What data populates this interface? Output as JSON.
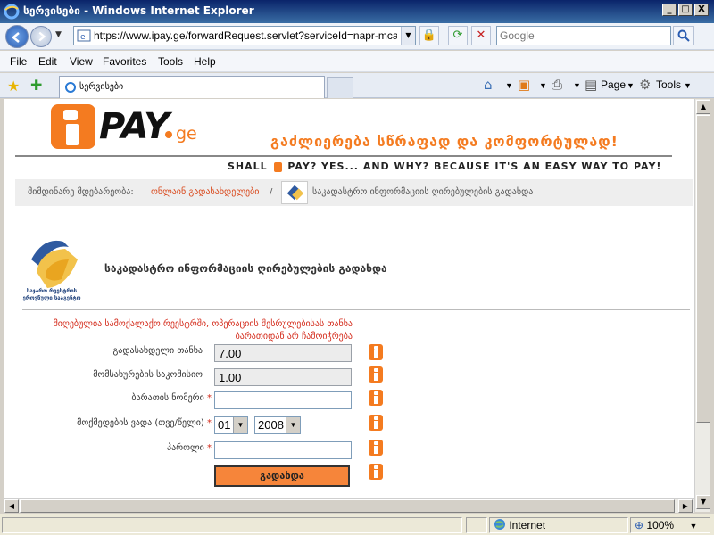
{
  "window": {
    "title": "სერვისები - Windows Internet Explorer",
    "minimize": "_",
    "maximize": "□",
    "close": "X"
  },
  "nav": {
    "url": "https://www.ipay.ge/forwardRequest.servlet?serviceId=napr-mcadmap",
    "search_placeholder": "Google"
  },
  "menu": {
    "items": [
      "File",
      "Edit",
      "View",
      "Favorites",
      "Tools",
      "Help"
    ]
  },
  "tabs": {
    "active_label": "სერვისები"
  },
  "commands": {
    "page": "Page",
    "tools": "Tools"
  },
  "header": {
    "logo_pay": "PAY",
    "logo_ge": "ge",
    "slogan_ka": "გაძლიერება სწრაფად და კომფორტულად!",
    "slogan_en_part1": "SHALL",
    "slogan_en_part2": "PAY? YES... AND WHY? BECAUSE IT'S AN EASY WAY TO PAY!"
  },
  "breadcrumb": {
    "current_label": "მიმდინარე მდებარეობა:",
    "link": "ონლაინ გადასახდელები",
    "separator": "/",
    "last": "საკადასტრო ინფორმაციის ღირებულების გადახდა"
  },
  "registry": {
    "caption": "საჯარო რეესტრის ეროვნული სააგენტო"
  },
  "page": {
    "heading": "საკადასტრო ინფორმაციის ღირებულების გადახდა",
    "notice": "მიღებულია სამოქალაქო რეესტრში, ოპერაციის შესრულებისას თანხა ბარათიდან არ ჩამოიჭრება"
  },
  "form": {
    "amount_label": "გადასახდელი თანხა",
    "amount_value": "7.00",
    "fee_label": "მომსახურების საკომისიო",
    "fee_value": "1.00",
    "card_label": "ბარათის ნომერი",
    "card_value": "",
    "expiry_label": "მოქმედების ვადა (თვე/წელი)",
    "expiry_month": "01",
    "expiry_year": "2008",
    "password_label": "პაროლი",
    "password_value": "",
    "required_mark": "*",
    "submit_label": "გადახდა"
  },
  "status": {
    "zone": "Internet",
    "zoom": "100%"
  },
  "colors": {
    "brand_orange": "#f47b20",
    "error_red": "#d42b1b",
    "link_red": "#d9481b"
  }
}
